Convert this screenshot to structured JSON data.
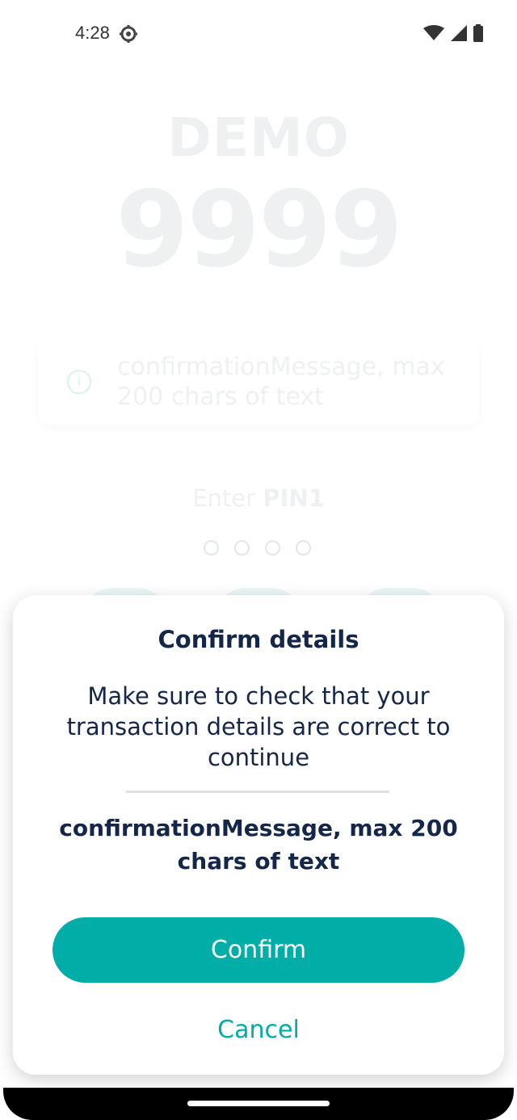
{
  "status_bar": {
    "time": "4:28",
    "icons": [
      "gear-icon",
      "wifi-icon",
      "signal-icon",
      "battery-icon"
    ]
  },
  "background": {
    "title": "DEMO",
    "pin_code": "9999",
    "info_message": "confirmationMessage, max 200 chars of text",
    "enter_prefix": "Enter",
    "enter_pin_label": "PIN1",
    "pin_dot_count": 4
  },
  "dialog": {
    "title": "Confirm details",
    "description": "Make sure to check that your transaction details are correct to continue",
    "message": "confirmationMessage, max 200 chars of text",
    "confirm_label": "Confirm",
    "cancel_label": "Cancel"
  },
  "colors": {
    "accent": "#00ada7",
    "text_primary": "#14264a",
    "background": "#ffffff"
  }
}
